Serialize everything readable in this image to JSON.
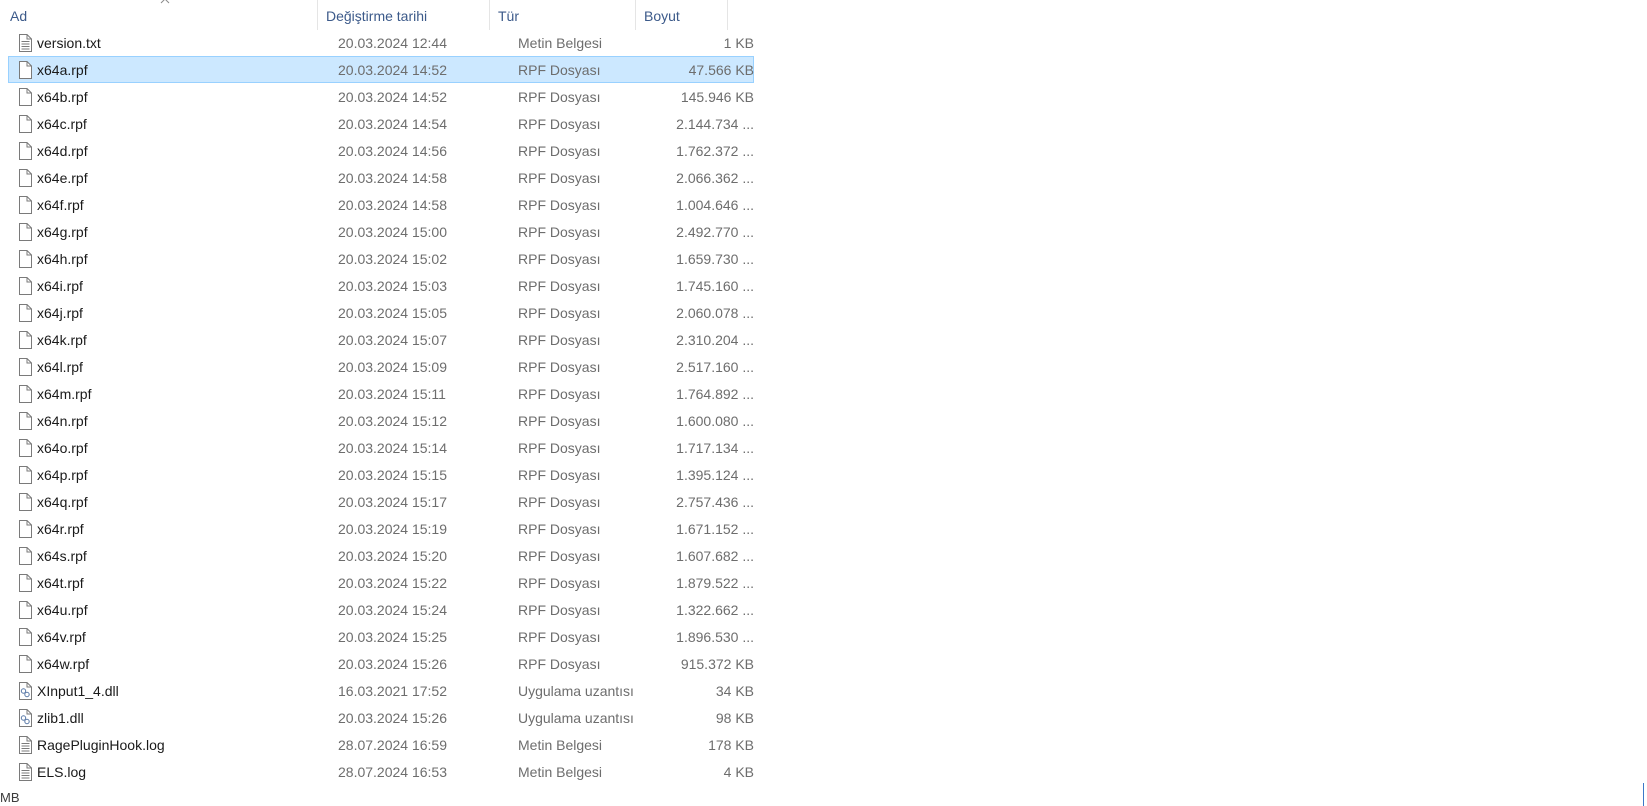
{
  "columns": {
    "name": "Ad",
    "date": "Değiştirme tarihi",
    "type": "Tür",
    "size": "Boyut"
  },
  "files": [
    {
      "name": "version.txt",
      "date": "20.03.2024 12:44",
      "type": "Metin Belgesi",
      "size": "1 KB",
      "icon": "text-file-icon",
      "selected": false
    },
    {
      "name": "x64a.rpf",
      "date": "20.03.2024 14:52",
      "type": "RPF Dosyası",
      "size": "47.566 KB",
      "icon": "blank-file-icon",
      "selected": true
    },
    {
      "name": "x64b.rpf",
      "date": "20.03.2024 14:52",
      "type": "RPF Dosyası",
      "size": "145.946 KB",
      "icon": "blank-file-icon",
      "selected": false
    },
    {
      "name": "x64c.rpf",
      "date": "20.03.2024 14:54",
      "type": "RPF Dosyası",
      "size": "2.144.734 ...",
      "icon": "blank-file-icon",
      "selected": false
    },
    {
      "name": "x64d.rpf",
      "date": "20.03.2024 14:56",
      "type": "RPF Dosyası",
      "size": "1.762.372 ...",
      "icon": "blank-file-icon",
      "selected": false
    },
    {
      "name": "x64e.rpf",
      "date": "20.03.2024 14:58",
      "type": "RPF Dosyası",
      "size": "2.066.362 ...",
      "icon": "blank-file-icon",
      "selected": false
    },
    {
      "name": "x64f.rpf",
      "date": "20.03.2024 14:58",
      "type": "RPF Dosyası",
      "size": "1.004.646 ...",
      "icon": "blank-file-icon",
      "selected": false
    },
    {
      "name": "x64g.rpf",
      "date": "20.03.2024 15:00",
      "type": "RPF Dosyası",
      "size": "2.492.770 ...",
      "icon": "blank-file-icon",
      "selected": false
    },
    {
      "name": "x64h.rpf",
      "date": "20.03.2024 15:02",
      "type": "RPF Dosyası",
      "size": "1.659.730 ...",
      "icon": "blank-file-icon",
      "selected": false
    },
    {
      "name": "x64i.rpf",
      "date": "20.03.2024 15:03",
      "type": "RPF Dosyası",
      "size": "1.745.160 ...",
      "icon": "blank-file-icon",
      "selected": false
    },
    {
      "name": "x64j.rpf",
      "date": "20.03.2024 15:05",
      "type": "RPF Dosyası",
      "size": "2.060.078 ...",
      "icon": "blank-file-icon",
      "selected": false
    },
    {
      "name": "x64k.rpf",
      "date": "20.03.2024 15:07",
      "type": "RPF Dosyası",
      "size": "2.310.204 ...",
      "icon": "blank-file-icon",
      "selected": false
    },
    {
      "name": "x64l.rpf",
      "date": "20.03.2024 15:09",
      "type": "RPF Dosyası",
      "size": "2.517.160 ...",
      "icon": "blank-file-icon",
      "selected": false
    },
    {
      "name": "x64m.rpf",
      "date": "20.03.2024 15:11",
      "type": "RPF Dosyası",
      "size": "1.764.892 ...",
      "icon": "blank-file-icon",
      "selected": false
    },
    {
      "name": "x64n.rpf",
      "date": "20.03.2024 15:12",
      "type": "RPF Dosyası",
      "size": "1.600.080 ...",
      "icon": "blank-file-icon",
      "selected": false
    },
    {
      "name": "x64o.rpf",
      "date": "20.03.2024 15:14",
      "type": "RPF Dosyası",
      "size": "1.717.134 ...",
      "icon": "blank-file-icon",
      "selected": false
    },
    {
      "name": "x64p.rpf",
      "date": "20.03.2024 15:15",
      "type": "RPF Dosyası",
      "size": "1.395.124 ...",
      "icon": "blank-file-icon",
      "selected": false
    },
    {
      "name": "x64q.rpf",
      "date": "20.03.2024 15:17",
      "type": "RPF Dosyası",
      "size": "2.757.436 ...",
      "icon": "blank-file-icon",
      "selected": false
    },
    {
      "name": "x64r.rpf",
      "date": "20.03.2024 15:19",
      "type": "RPF Dosyası",
      "size": "1.671.152 ...",
      "icon": "blank-file-icon",
      "selected": false
    },
    {
      "name": "x64s.rpf",
      "date": "20.03.2024 15:20",
      "type": "RPF Dosyası",
      "size": "1.607.682 ...",
      "icon": "blank-file-icon",
      "selected": false
    },
    {
      "name": "x64t.rpf",
      "date": "20.03.2024 15:22",
      "type": "RPF Dosyası",
      "size": "1.879.522 ...",
      "icon": "blank-file-icon",
      "selected": false
    },
    {
      "name": "x64u.rpf",
      "date": "20.03.2024 15:24",
      "type": "RPF Dosyası",
      "size": "1.322.662 ...",
      "icon": "blank-file-icon",
      "selected": false
    },
    {
      "name": "x64v.rpf",
      "date": "20.03.2024 15:25",
      "type": "RPF Dosyası",
      "size": "1.896.530 ...",
      "icon": "blank-file-icon",
      "selected": false
    },
    {
      "name": "x64w.rpf",
      "date": "20.03.2024 15:26",
      "type": "RPF Dosyası",
      "size": "915.372 KB",
      "icon": "blank-file-icon",
      "selected": false
    },
    {
      "name": "XInput1_4.dll",
      "date": "16.03.2021 17:52",
      "type": "Uygulama uzantısı",
      "size": "34 KB",
      "icon": "dll-file-icon",
      "selected": false
    },
    {
      "name": "zlib1.dll",
      "date": "20.03.2024 15:26",
      "type": "Uygulama uzantısı",
      "size": "98 KB",
      "icon": "dll-file-icon",
      "selected": false
    },
    {
      "name": "RagePluginHook.log",
      "date": "28.07.2024 16:59",
      "type": "Metin Belgesi",
      "size": "178 KB",
      "icon": "text-file-icon",
      "selected": false
    },
    {
      "name": "ELS.log",
      "date": "28.07.2024 16:53",
      "type": "Metin Belgesi",
      "size": "4 KB",
      "icon": "text-file-icon",
      "selected": false
    }
  ],
  "status_bar": {
    "size_text": "MB"
  },
  "colors": {
    "header_text": "#3c5a8a",
    "selected_bg": "#cce8ff",
    "selected_border": "#99d1ff",
    "secondary_text": "#6d6d6d"
  }
}
